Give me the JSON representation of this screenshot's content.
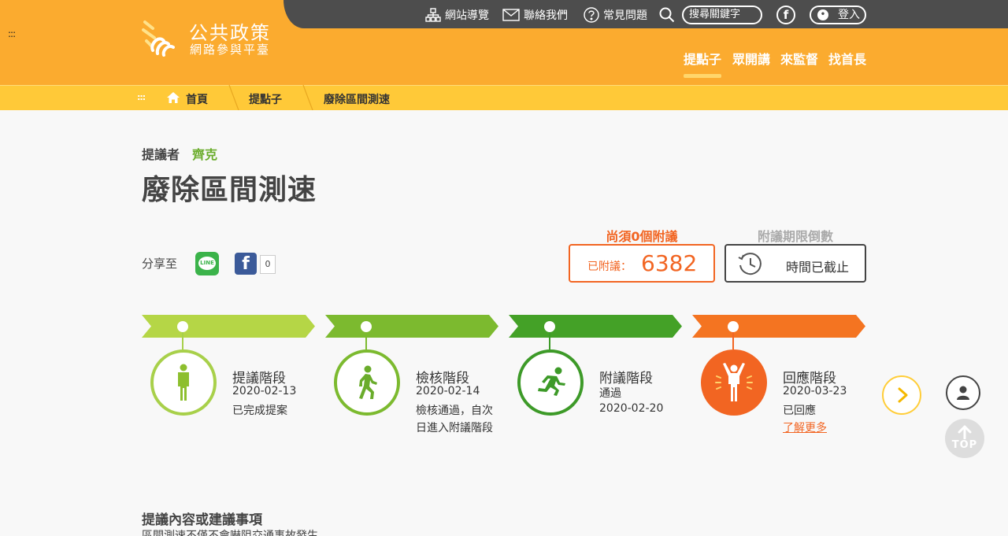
{
  "header": {
    "logo_title": "公共政策",
    "logo_subtitle": "網路參與平臺",
    "top_links": [
      "網站導覽",
      "聯絡我們",
      "常見問題"
    ],
    "search_placeholder": "搜尋關鍵字",
    "login_label": "登入",
    "nav": [
      "提點子",
      "眾開講",
      "來監督",
      "找首長"
    ],
    "active_nav": "提點子",
    "menu_glyph": ":::",
    "fb_glyph": "f"
  },
  "breadcrumb": {
    "menu_glyph": ":::",
    "home": "首頁",
    "items": [
      "提點子",
      "廢除區間測速"
    ]
  },
  "proposal": {
    "proposer_label": "提議者",
    "proposer_name": "齊克",
    "title": "廢除區間測速"
  },
  "share": {
    "label": "分享至",
    "line_text": "LINE",
    "fb_text": "f",
    "fb_count": "0"
  },
  "endorsement": {
    "need_text": "尚須0個附議",
    "count_label": "已附議：",
    "count_value": "6382",
    "deadline_title": "附議期限倒數",
    "deadline_text": "時間已截止"
  },
  "stages": [
    {
      "title": "提議階段",
      "line1": "2020-02-13",
      "line2": "已完成提案",
      "line3": "",
      "color": "#a8d04a",
      "icon": "standing-person-icon"
    },
    {
      "title": "檢核階段",
      "line1": "2020-02-14",
      "line2": "檢核通過，自次",
      "line3": "日進入附議階段",
      "color": "#7cba2f",
      "icon": "walking-person-icon"
    },
    {
      "title": "附議階段",
      "line1": "通過",
      "line2": "2020-02-20",
      "line3": "",
      "color": "#3d9a28",
      "icon": "running-person-icon"
    },
    {
      "title": "回應階段",
      "line1": "2020-03-23",
      "line2": "已回應",
      "line3": "",
      "color": "#f26522",
      "icon": "cheering-person-icon",
      "link": "了解更多"
    }
  ],
  "side": {
    "top_label": "TOP"
  },
  "content": {
    "heading": "提議內容或建議事項",
    "first_line": "區間測速不僅不會嚇阻交通事故發生"
  },
  "colors": {
    "header": "#fbab2f",
    "topbar": "#4d4d4d",
    "crumbbar": "#ffc938",
    "accent_orange": "#f26522"
  }
}
